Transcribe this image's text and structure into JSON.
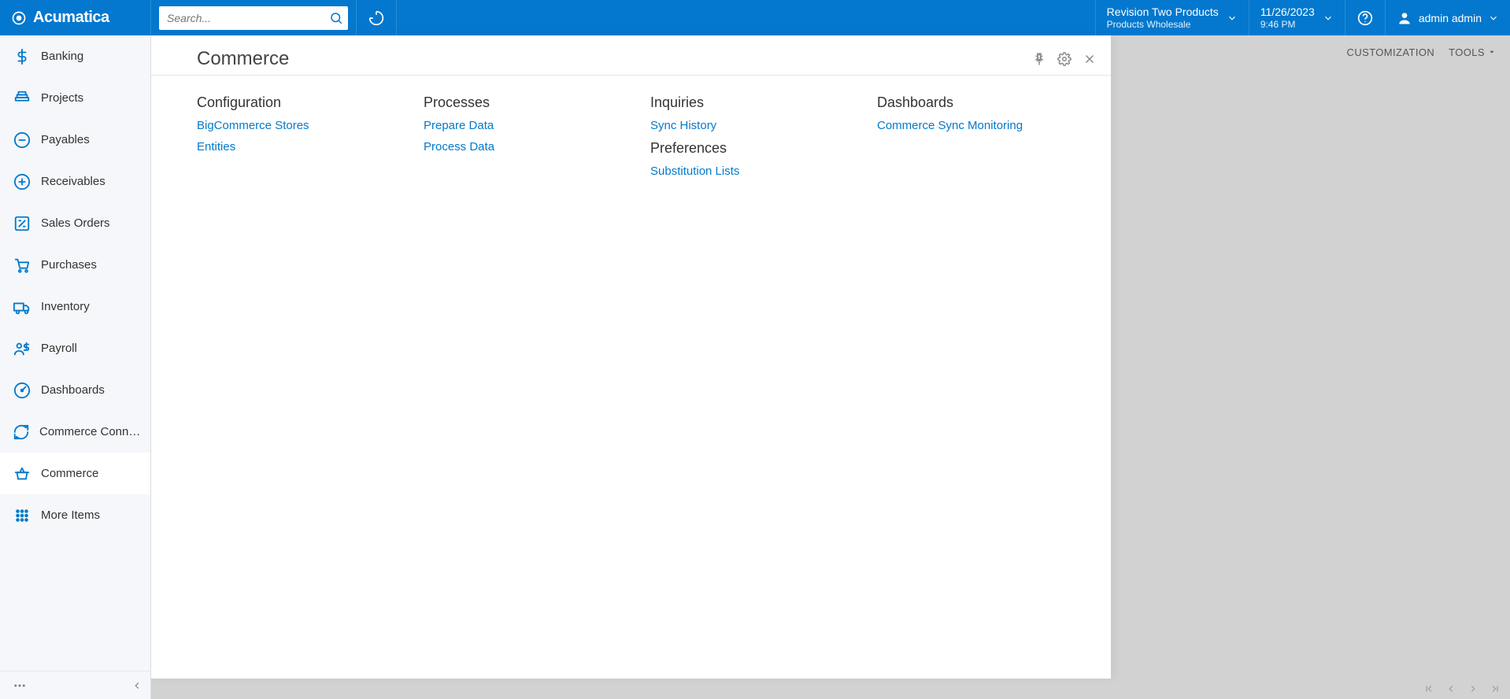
{
  "brand": "Acumatica",
  "search": {
    "placeholder": "Search..."
  },
  "tenant": {
    "line1": "Revision Two Products",
    "line2": "Products Wholesale"
  },
  "clock": {
    "date": "11/26/2023",
    "time": "9:46 PM"
  },
  "user": {
    "name": "admin admin"
  },
  "bg_toolbar": {
    "customization": "CUSTOMIZATION",
    "tools": "TOOLS"
  },
  "sidebar": {
    "items": [
      {
        "icon": "dollar",
        "label": "Banking"
      },
      {
        "icon": "layers",
        "label": "Projects"
      },
      {
        "icon": "circle-minus",
        "label": "Payables"
      },
      {
        "icon": "circle-plus",
        "label": "Receivables"
      },
      {
        "icon": "edit-square",
        "label": "Sales Orders"
      },
      {
        "icon": "cart",
        "label": "Purchases"
      },
      {
        "icon": "truck",
        "label": "Inventory"
      },
      {
        "icon": "people-dollar",
        "label": "Payroll"
      },
      {
        "icon": "gauge",
        "label": "Dashboards"
      },
      {
        "icon": "sync",
        "label": "Commerce Connec..."
      },
      {
        "icon": "basket",
        "label": "Commerce",
        "active": true
      },
      {
        "icon": "grid",
        "label": "More Items"
      }
    ]
  },
  "panel": {
    "title": "Commerce",
    "columns": [
      {
        "sections": [
          {
            "heading": "Configuration",
            "links": [
              "BigCommerce Stores",
              "Entities"
            ]
          }
        ]
      },
      {
        "sections": [
          {
            "heading": "Processes",
            "links": [
              "Prepare Data",
              "Process Data"
            ]
          }
        ]
      },
      {
        "sections": [
          {
            "heading": "Inquiries",
            "links": [
              "Sync History"
            ]
          },
          {
            "heading": "Preferences",
            "links": [
              "Substitution Lists"
            ]
          }
        ]
      },
      {
        "sections": [
          {
            "heading": "Dashboards",
            "links": [
              "Commerce Sync Monitoring"
            ]
          }
        ]
      }
    ]
  },
  "colors": {
    "primary": "#0378ce",
    "link": "#027acc"
  }
}
